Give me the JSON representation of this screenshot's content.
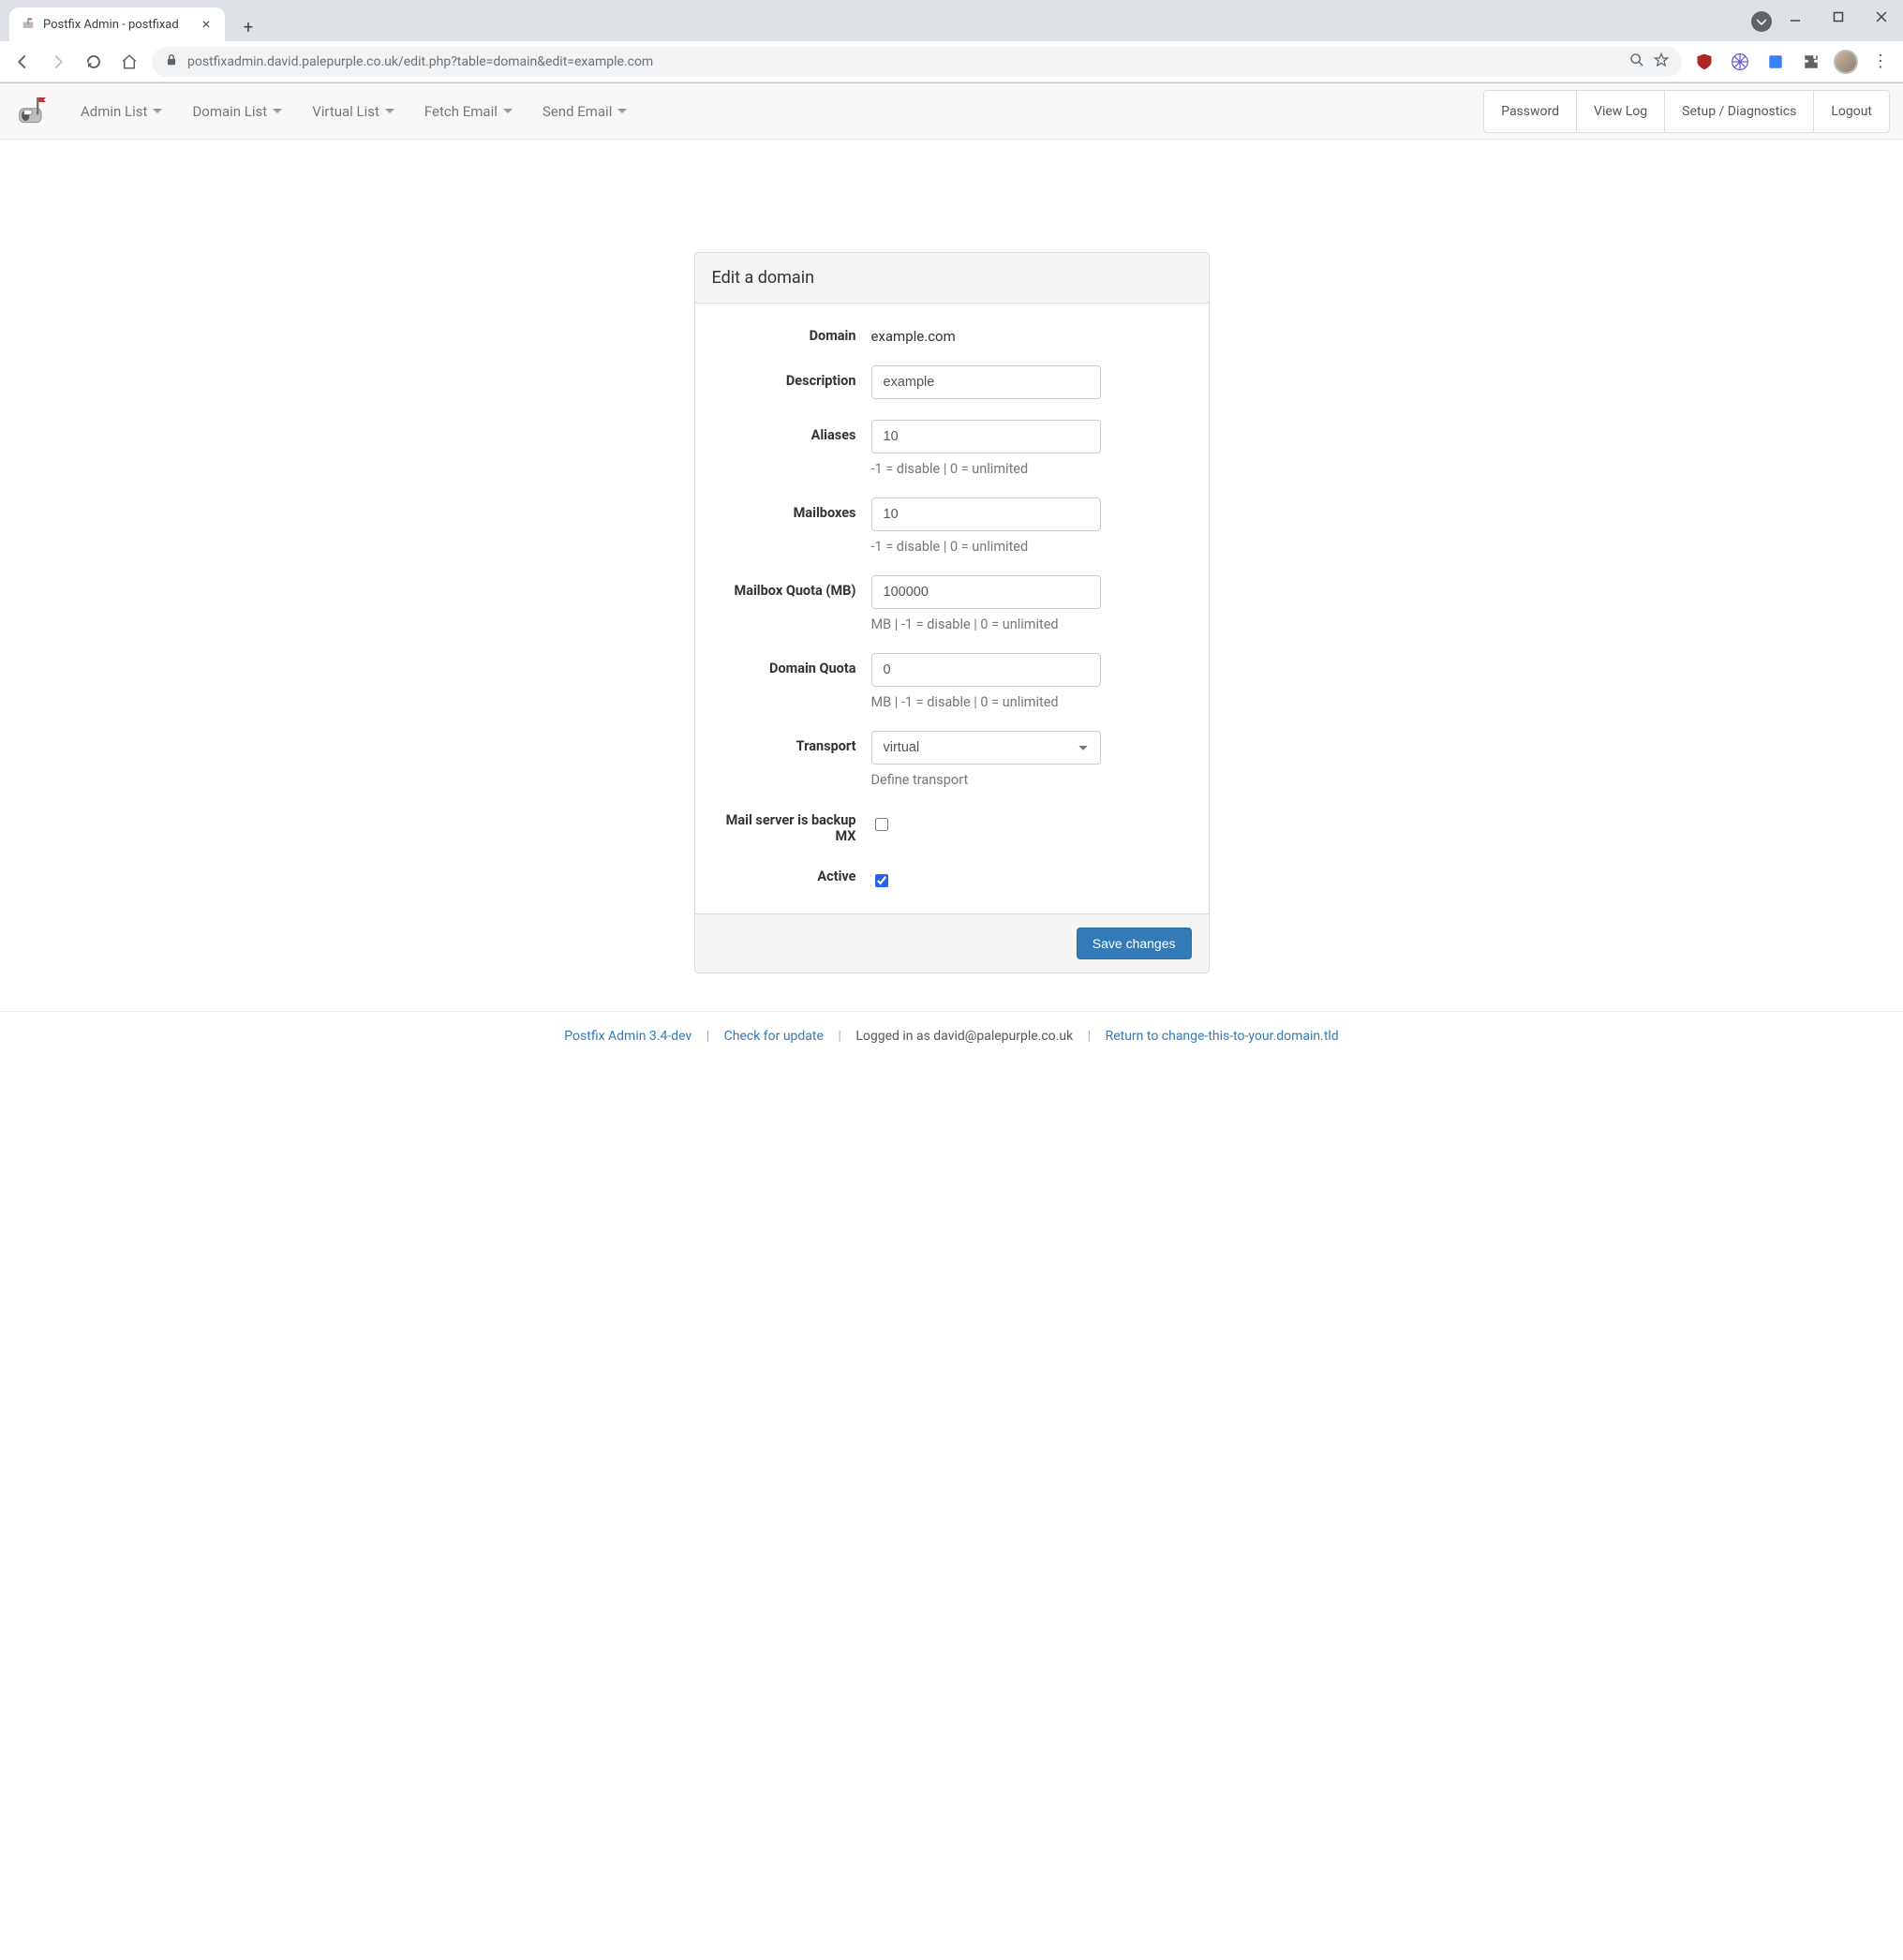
{
  "browser": {
    "tab_title": "Postfix Admin - postfixad",
    "url_host": "postfixadmin.david.palepurple.co.uk",
    "url_path": "/edit.php?table=domain&edit=example.com"
  },
  "nav": {
    "menus": [
      "Admin List",
      "Domain List",
      "Virtual List",
      "Fetch Email",
      "Send Email"
    ],
    "buttons": [
      "Password",
      "View Log",
      "Setup / Diagnostics",
      "Logout"
    ]
  },
  "panel": {
    "title": "Edit a domain",
    "submit": "Save changes"
  },
  "form": {
    "domain": {
      "label": "Domain",
      "value": "example.com"
    },
    "description": {
      "label": "Description",
      "value": "example"
    },
    "aliases": {
      "label": "Aliases",
      "value": "10",
      "help": "-1 = disable | 0 = unlimited"
    },
    "mailboxes": {
      "label": "Mailboxes",
      "value": "10",
      "help": "-1 = disable | 0 = unlimited"
    },
    "mailbox_quota": {
      "label": "Mailbox Quota (MB)",
      "value": "100000",
      "help": "MB | -1 = disable | 0 = unlimited"
    },
    "domain_quota": {
      "label": "Domain Quota",
      "value": "0",
      "help": "MB | -1 = disable | 0 = unlimited"
    },
    "transport": {
      "label": "Transport",
      "value": "virtual",
      "help": "Define transport"
    },
    "backup_mx": {
      "label": "Mail server is backup MX",
      "checked": false
    },
    "active": {
      "label": "Active",
      "checked": true
    }
  },
  "footer": {
    "version": "Postfix Admin 3.4-dev",
    "check_update": "Check for update",
    "logged_in": "Logged in as david@palepurple.co.uk",
    "return_link": "Return to change-this-to-your.domain.tld"
  }
}
